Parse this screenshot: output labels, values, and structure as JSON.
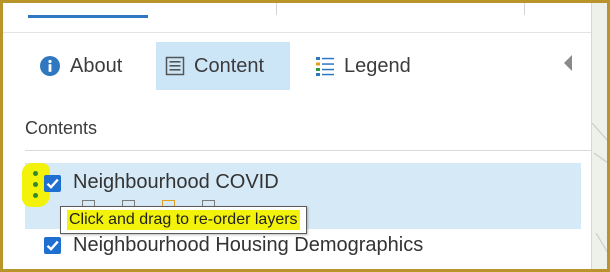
{
  "colors": {
    "accent": "#2f77c0",
    "selected_tab_bg": "#cde6f7",
    "selected_row_bg": "#d6e9f6",
    "checkbox": "#1f6fd0",
    "highlight": "#f2f20a",
    "frame": "#b9942a"
  },
  "tabs": [
    {
      "label": "About",
      "icon": "info-icon"
    },
    {
      "label": "Content",
      "icon": "content-list-icon",
      "selected": true
    },
    {
      "label": "Legend",
      "icon": "legend-list-icon"
    }
  ],
  "contents": {
    "title": "Contents",
    "layers": [
      {
        "name": "Neighbourhood COVID",
        "checked": true,
        "selected": true
      },
      {
        "name": "Neighbourhood Housing Demographics",
        "checked": true,
        "selected": false
      }
    ]
  },
  "tooltip": {
    "text": "Click and drag to re-order layers"
  },
  "icons": {
    "drag_handle": "drag-handle-icon",
    "collapse": "collapse-left-arrow-icon"
  }
}
